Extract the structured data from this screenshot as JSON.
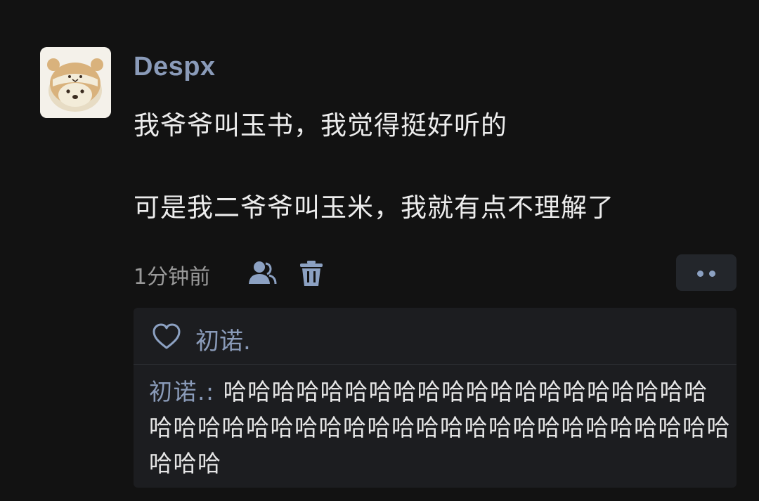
{
  "post": {
    "username": "Despx",
    "lines": [
      "我爷爷叫玉书，我觉得挺好听的",
      "可是我二爷爷叫玉米，我就有点不理解了"
    ],
    "time": "1分钟前",
    "icons": {
      "user": "user-icon",
      "trash": "trash-icon",
      "more": "more-dots-icon",
      "heart": "heart-outline-icon"
    }
  },
  "likes": {
    "names": "初诺."
  },
  "comments": [
    {
      "author": "初诺.",
      "separator": ": ",
      "text": "哈哈哈哈哈哈哈哈哈哈哈哈哈哈哈哈哈哈哈哈哈哈哈哈哈哈哈哈哈哈哈哈哈哈哈哈哈哈哈哈哈哈哈哈哈哈哈"
    }
  ],
  "colors": {
    "background": "#121212",
    "accent": "#8a9bb9",
    "text": "#ececec",
    "muted": "#9a9a9a",
    "panel": "#1c1d20"
  }
}
